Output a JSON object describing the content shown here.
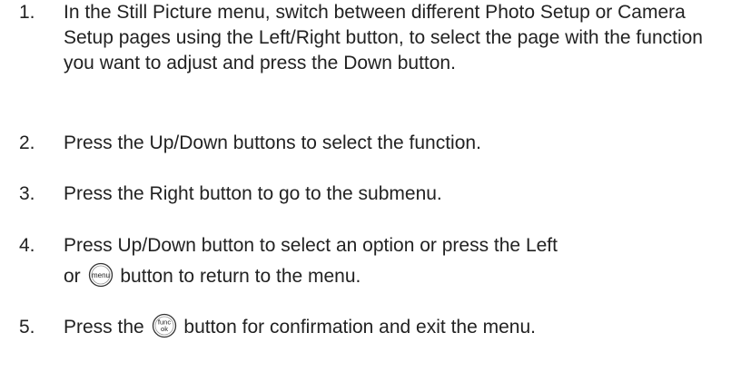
{
  "steps": [
    {
      "number": "1.",
      "text": "In the Still Picture menu, switch between different Photo Setup or Camera Setup pages using the Left/Right button, to select the page with the function you want to adjust and press the Down button."
    },
    {
      "number": "2.",
      "text": "Press the Up/Down buttons to select the function."
    },
    {
      "number": "3.",
      "text": "Press the Right button to go to the submenu."
    },
    {
      "number": "4.",
      "text_line1": "Press Up/Down button to select an option or press the Left",
      "text_before_icon": "or",
      "icon_label": "menu",
      "text_after_icon": "button to return to the menu."
    },
    {
      "number": "5.",
      "text_before_icon": "Press the",
      "icon_label_top": "func",
      "icon_label_bottom": "ok",
      "text_after_icon": "button for confirmation and exit the menu."
    }
  ]
}
